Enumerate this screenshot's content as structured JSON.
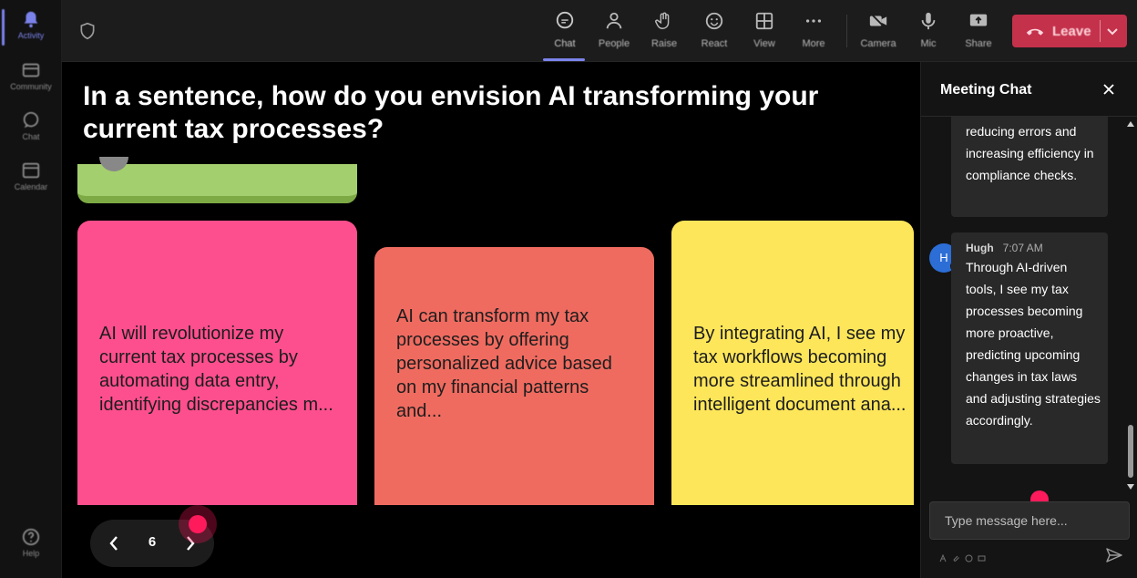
{
  "rail": {
    "items": [
      {
        "label": "Activity",
        "icon": "bell-icon"
      },
      {
        "label": "Community",
        "icon": "community-icon"
      },
      {
        "label": "Chat",
        "icon": "chat-icon"
      },
      {
        "label": "Calendar",
        "icon": "calendar-icon"
      },
      {
        "label": "Help",
        "icon": "help-icon"
      }
    ]
  },
  "toolbar": {
    "chat": "Chat",
    "people": "People",
    "raise": "Raise",
    "react": "React",
    "view": "View",
    "more": "More",
    "camera": "Camera",
    "mic": "Mic",
    "share": "Share",
    "leave": "Leave"
  },
  "board": {
    "question": "In a sentence, how do you envision AI transforming your current tax processes?",
    "notes": [
      "AI will revolutionize my current tax processes by automating data entry, identifying discrepancies m...",
      "AI can transform my tax processes by offering personalized advice based on my financial patterns and...",
      "By integrating AI, I see my tax workflows becoming more streamlined through intelligent document ana..."
    ],
    "page": "6"
  },
  "chat": {
    "title": "Meeting Chat",
    "messages": [
      {
        "text": "reducing errors and increasing efficiency in compliance checks."
      },
      {
        "initial": "H",
        "author": "Hugh",
        "time": "7:07 AM",
        "text": "Through AI-driven tools, I see my tax processes becoming more proactive, predicting upcoming changes in tax laws and adjusting strategies accordingly."
      }
    ],
    "input_placeholder": "Type message here..."
  },
  "colors": {
    "accent": "#7b83eb",
    "leave": "#c4314b",
    "note_pink": "#fd4f8d",
    "note_coral": "#ef6b60",
    "note_yellow": "#fde65a",
    "note_green": "#a4cf6e",
    "avatar": "#2c6ed6",
    "cursor": "#ff1a5c"
  }
}
